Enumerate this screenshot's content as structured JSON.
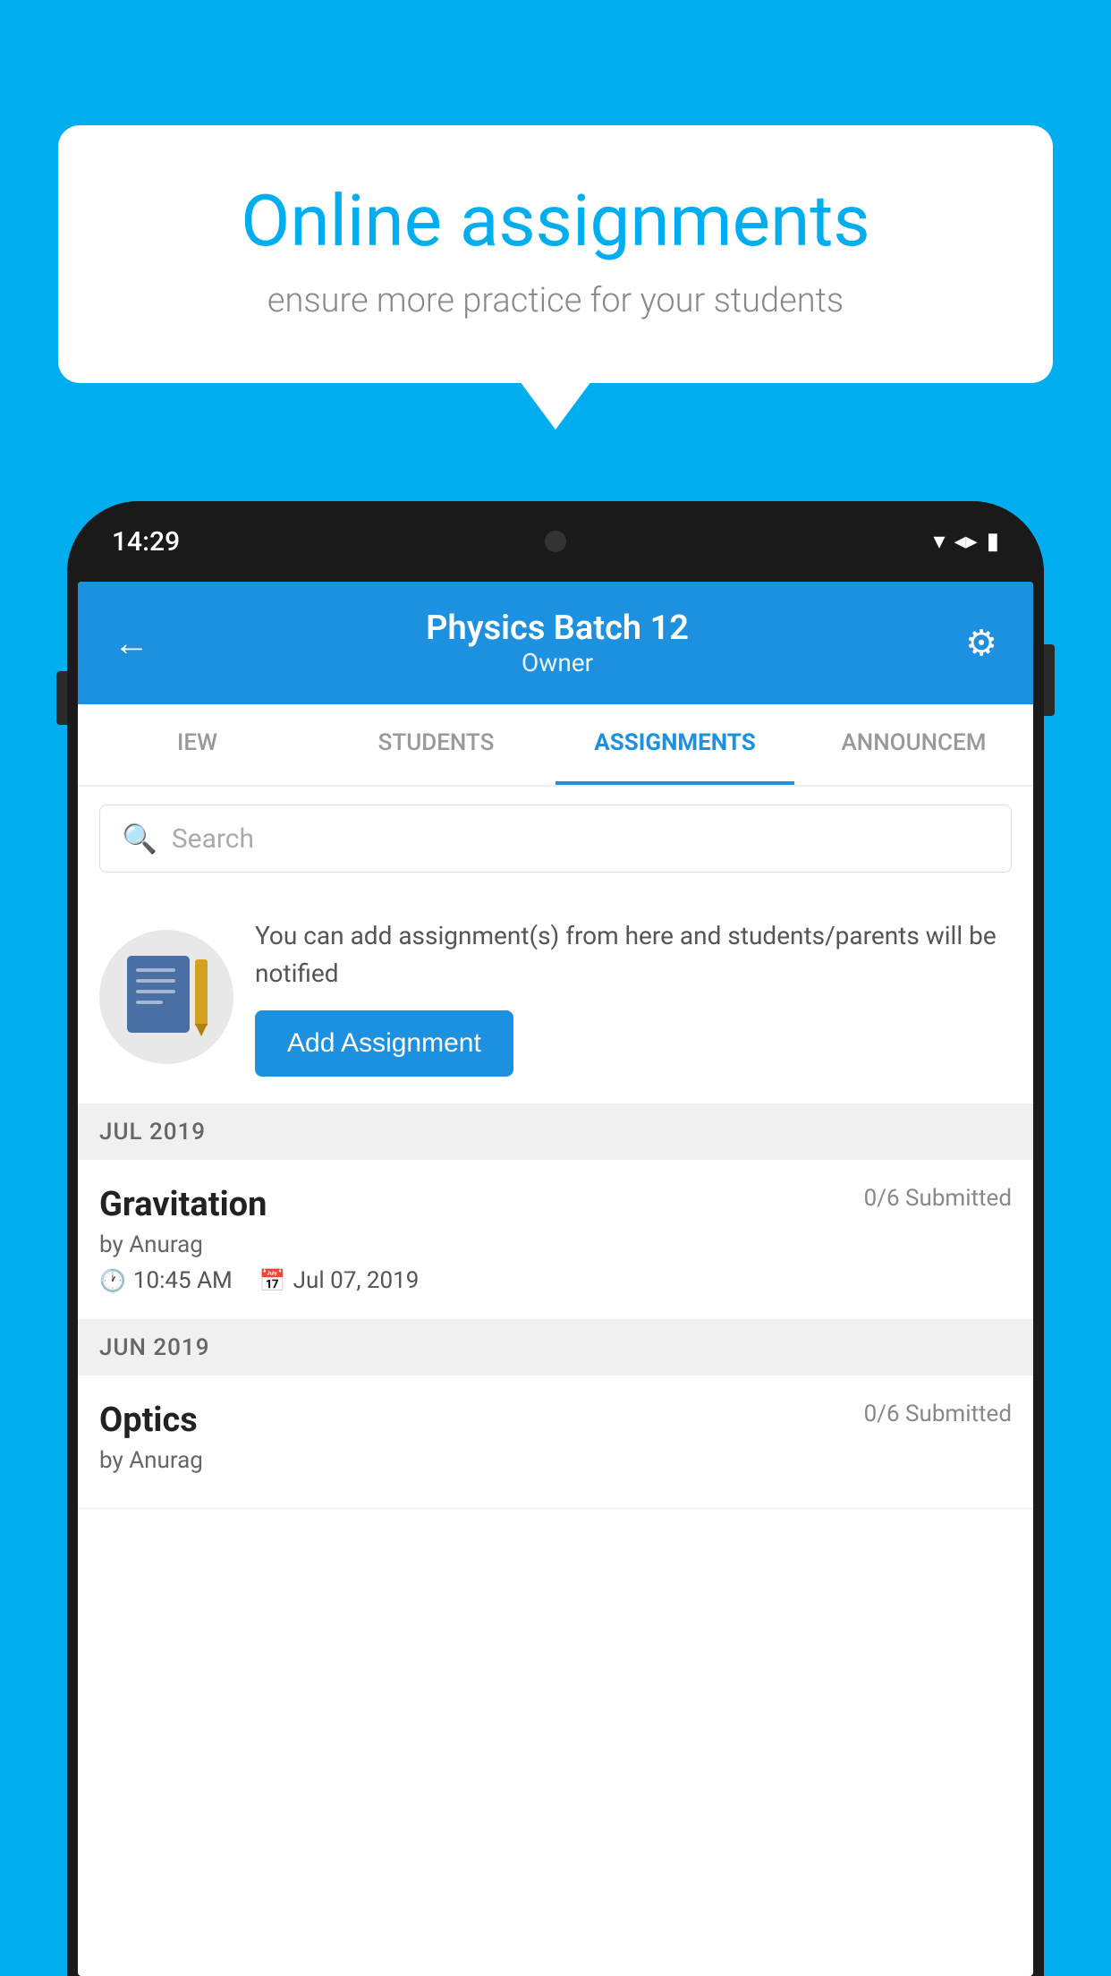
{
  "background_color": "#00AEEF",
  "speech_bubble": {
    "title": "Online assignments",
    "subtitle": "ensure more practice for your students"
  },
  "phone": {
    "status_bar": {
      "time": "14:29"
    },
    "header": {
      "title": "Physics Batch 12",
      "subtitle": "Owner",
      "back_icon": "←",
      "settings_icon": "⚙"
    },
    "tabs": [
      {
        "label": "IEW",
        "active": false
      },
      {
        "label": "STUDENTS",
        "active": false
      },
      {
        "label": "ASSIGNMENTS",
        "active": true
      },
      {
        "label": "ANNOUNCEM",
        "active": false
      }
    ],
    "search": {
      "placeholder": "Search"
    },
    "promo": {
      "text": "You can add assignment(s) from here and students/parents will be notified",
      "button_label": "Add Assignment"
    },
    "sections": [
      {
        "month_label": "JUL 2019",
        "assignments": [
          {
            "name": "Gravitation",
            "submitted": "0/6 Submitted",
            "by": "by Anurag",
            "time": "10:45 AM",
            "date": "Jul 07, 2019"
          }
        ]
      },
      {
        "month_label": "JUN 2019",
        "assignments": [
          {
            "name": "Optics",
            "submitted": "0/6 Submitted",
            "by": "by Anurag",
            "time": "",
            "date": ""
          }
        ]
      }
    ]
  }
}
